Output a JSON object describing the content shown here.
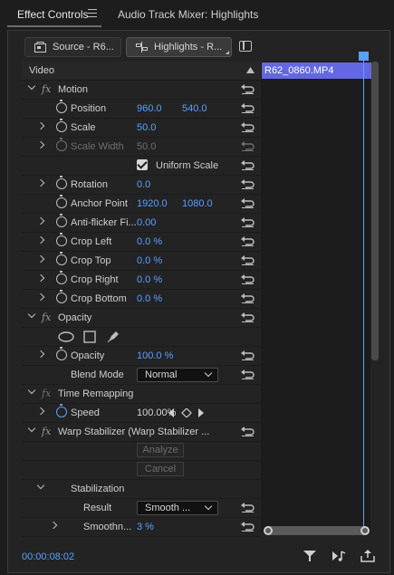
{
  "tabs": {
    "active": "Effect Controls",
    "inactive": "Audio Track Mixer: Highlights"
  },
  "sources": {
    "source": "Source - R6...",
    "sequence": "Highlights - R..."
  },
  "header": {
    "video_label": "Video"
  },
  "clip": {
    "name": "R62_0860.MP4"
  },
  "motion": {
    "label": "Motion",
    "position_label": "Position",
    "position_x": "960.0",
    "position_y": "540.0",
    "scale_label": "Scale",
    "scale_value": "50.0",
    "scale_width_label": "Scale Width",
    "scale_width_value": "50.0",
    "uniform_scale_label": "Uniform Scale",
    "rotation_label": "Rotation",
    "rotation_value": "0.0",
    "anchor_label": "Anchor Point",
    "anchor_x": "1920.0",
    "anchor_y": "1080.0",
    "antiflicker_label": "Anti-flicker Fi...",
    "antiflicker_value": "0.00",
    "crop_left_label": "Crop Left",
    "crop_left_value": "0.0 %",
    "crop_top_label": "Crop Top",
    "crop_top_value": "0.0 %",
    "crop_right_label": "Crop Right",
    "crop_right_value": "0.0 %",
    "crop_bottom_label": "Crop Bottom",
    "crop_bottom_value": "0.0 %"
  },
  "opacity": {
    "label": "Opacity",
    "opacity_label": "Opacity",
    "opacity_value": "100.0 %",
    "blend_label": "Blend Mode",
    "blend_value": "Normal"
  },
  "time_remap": {
    "label": "Time Remapping",
    "speed_label": "Speed",
    "speed_value": "100.00%"
  },
  "warp": {
    "label": "Warp Stabilizer (Warp Stabilizer ...",
    "analyze_label": "Analyze",
    "cancel_label": "Cancel",
    "stabilization_label": "Stabilization",
    "result_label": "Result",
    "result_value": "Smooth ...",
    "smoothness_label": "Smoothn...",
    "smoothness_value": "3 %"
  },
  "footer": {
    "timecode": "00:00:08:02"
  },
  "colors": {
    "accent": "#5aa0ff",
    "clip": "#6467e2",
    "background": "#1d1d1d"
  },
  "icons": [
    "menu-icon",
    "source-icon",
    "sequence-icon",
    "layout-icon",
    "fx-icon",
    "stopwatch-icon",
    "reset-icon",
    "ellipse-mask-icon",
    "rect-mask-icon",
    "pen-mask-icon",
    "keyframe-icon",
    "filter-icon",
    "play-audio-icon",
    "export-icon"
  ]
}
